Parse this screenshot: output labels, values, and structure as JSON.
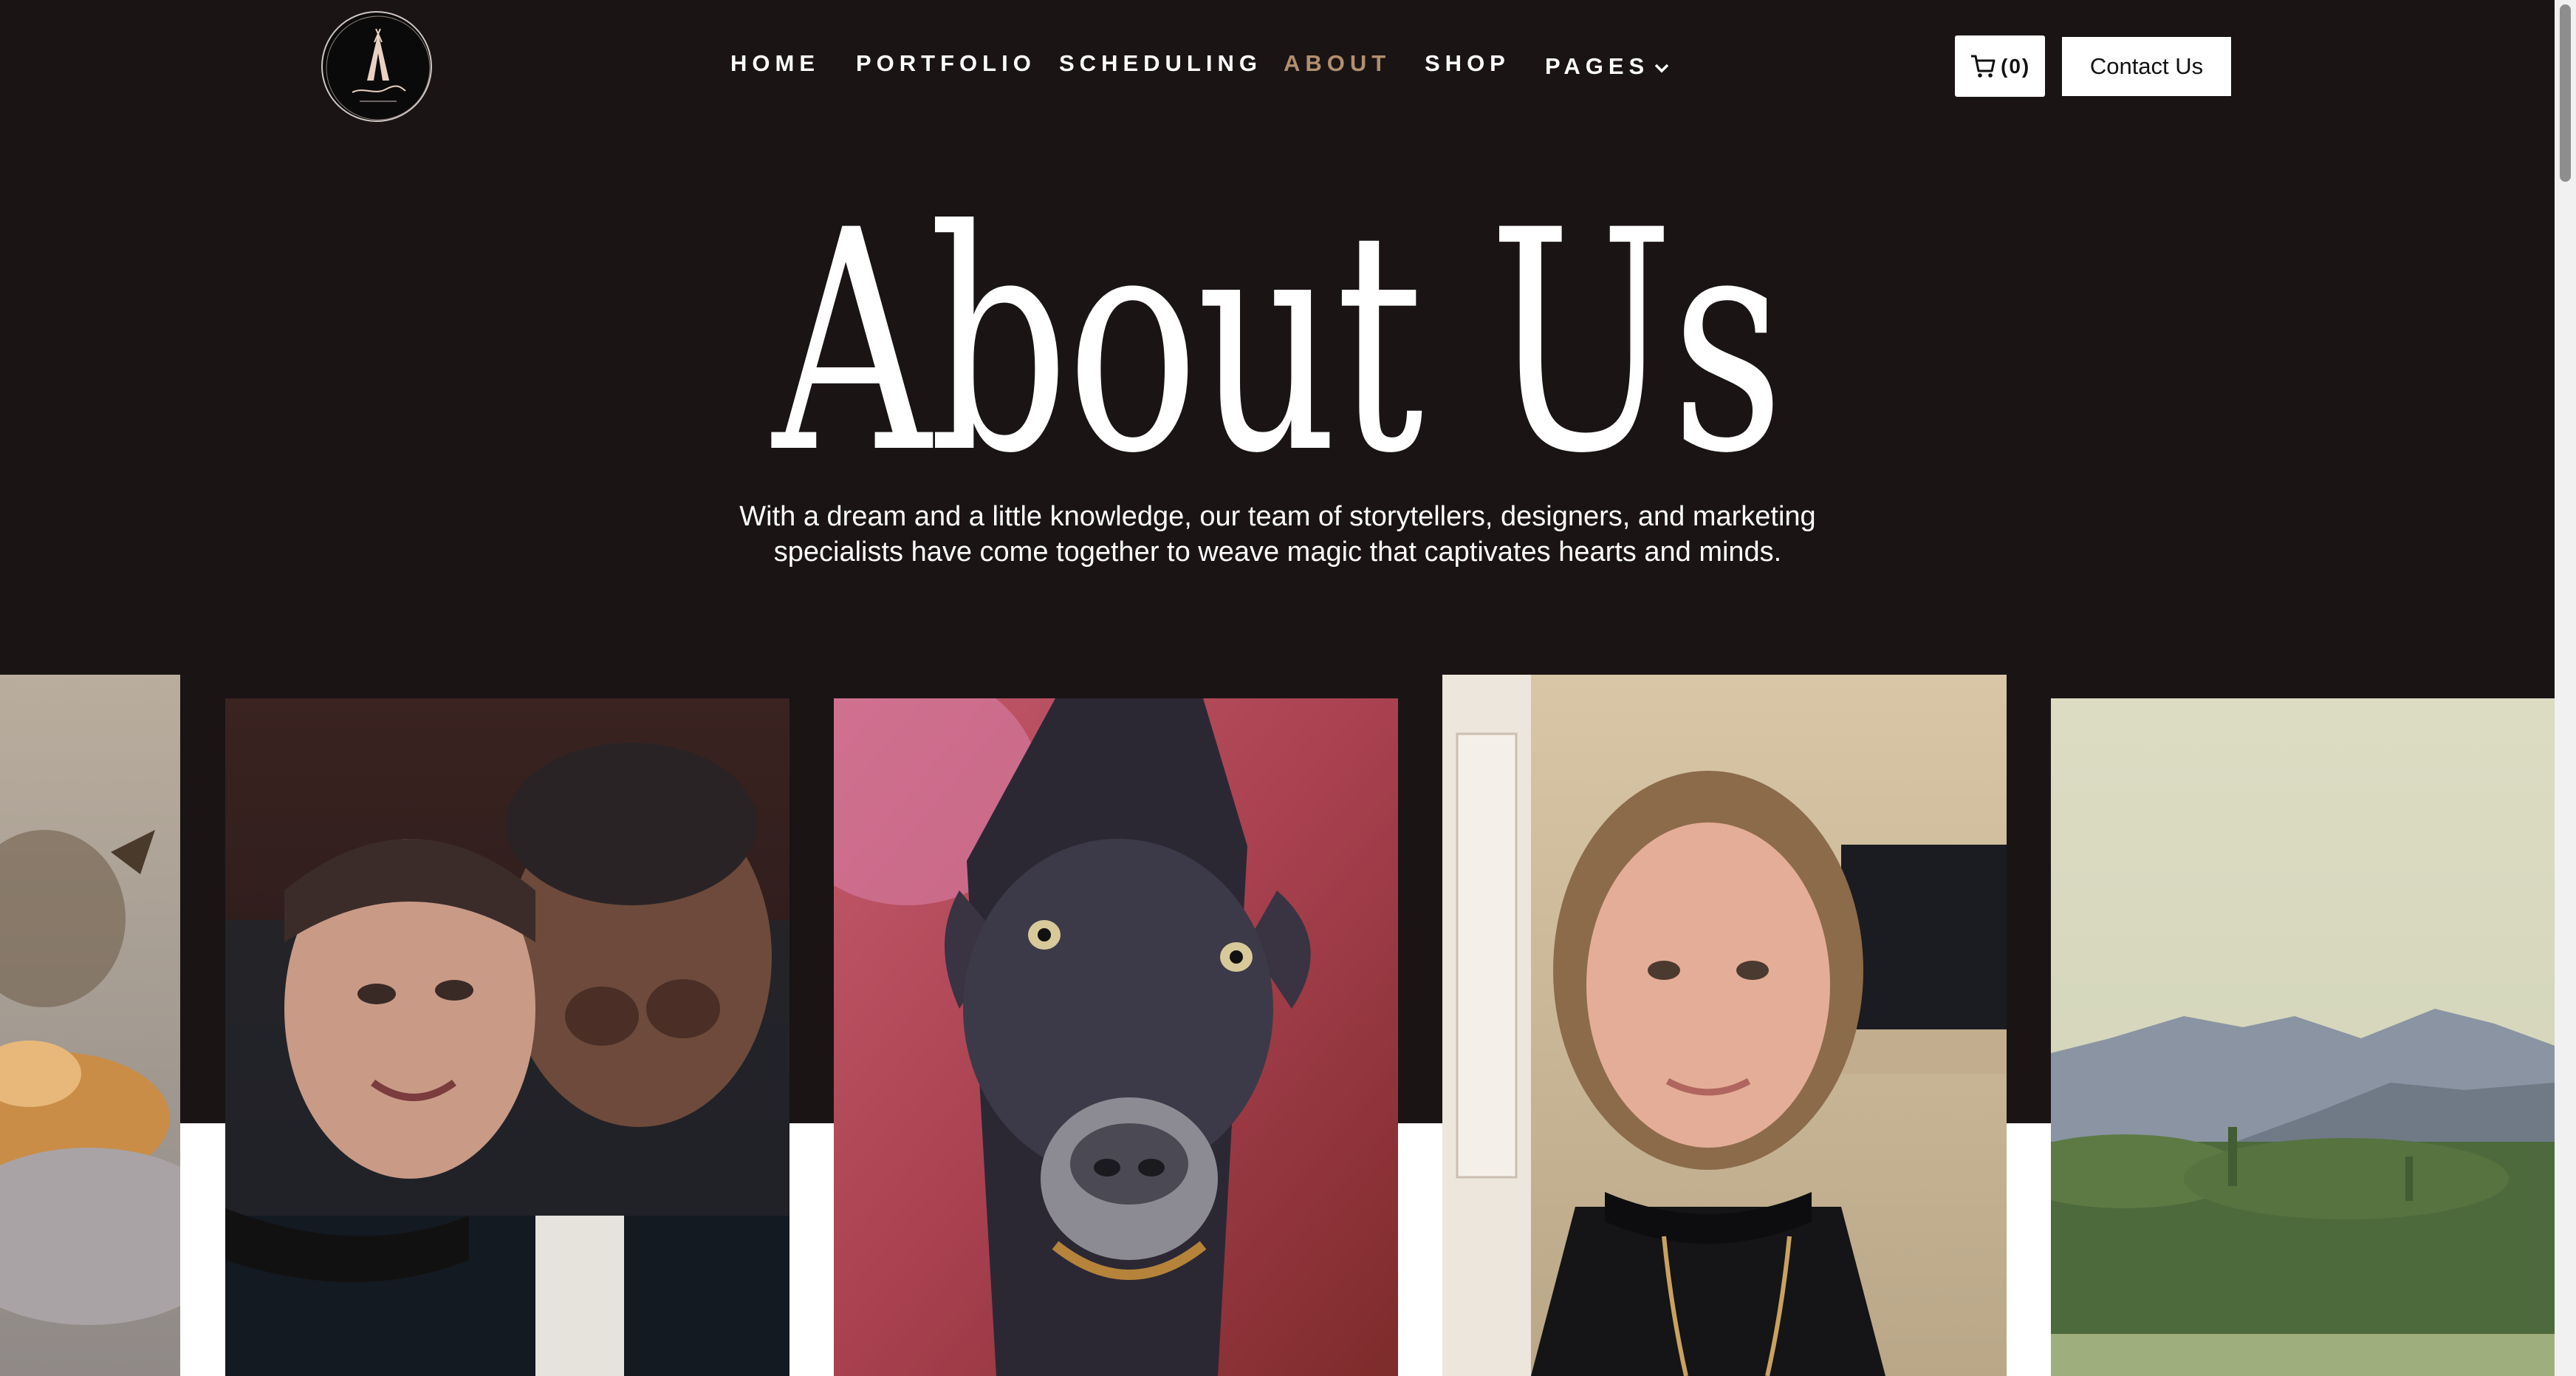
{
  "header": {
    "logo_alt": "Blackalbos logo",
    "nav": [
      {
        "label": "HOME",
        "active": false
      },
      {
        "label": "PORTFOLIO",
        "active": false
      },
      {
        "label": "SCHEDULING",
        "active": false
      },
      {
        "label": "ABOUT",
        "active": true
      },
      {
        "label": "SHOP",
        "active": false
      },
      {
        "label": "PAGES",
        "active": false,
        "has_dropdown": true
      }
    ],
    "cart_count": "(0)",
    "cart_icon": "cart-icon",
    "contact_label": "Contact Us"
  },
  "hero": {
    "title": "About Us",
    "subtitle": "With a dream and a little knowledge, our team of storytellers, designers, and marketing specialists have come together to weave magic that captivates hearts and minds."
  },
  "gallery": {
    "photos": [
      {
        "subject": "dog close-up (partial)"
      },
      {
        "subject": "couple selfie"
      },
      {
        "subject": "doberman dog looking up"
      },
      {
        "subject": "woman selfie"
      },
      {
        "subject": "desert mountain landscape"
      }
    ]
  },
  "colors": {
    "background": "#1a1415",
    "accent": "#b38f6e",
    "text": "#ffffff"
  }
}
